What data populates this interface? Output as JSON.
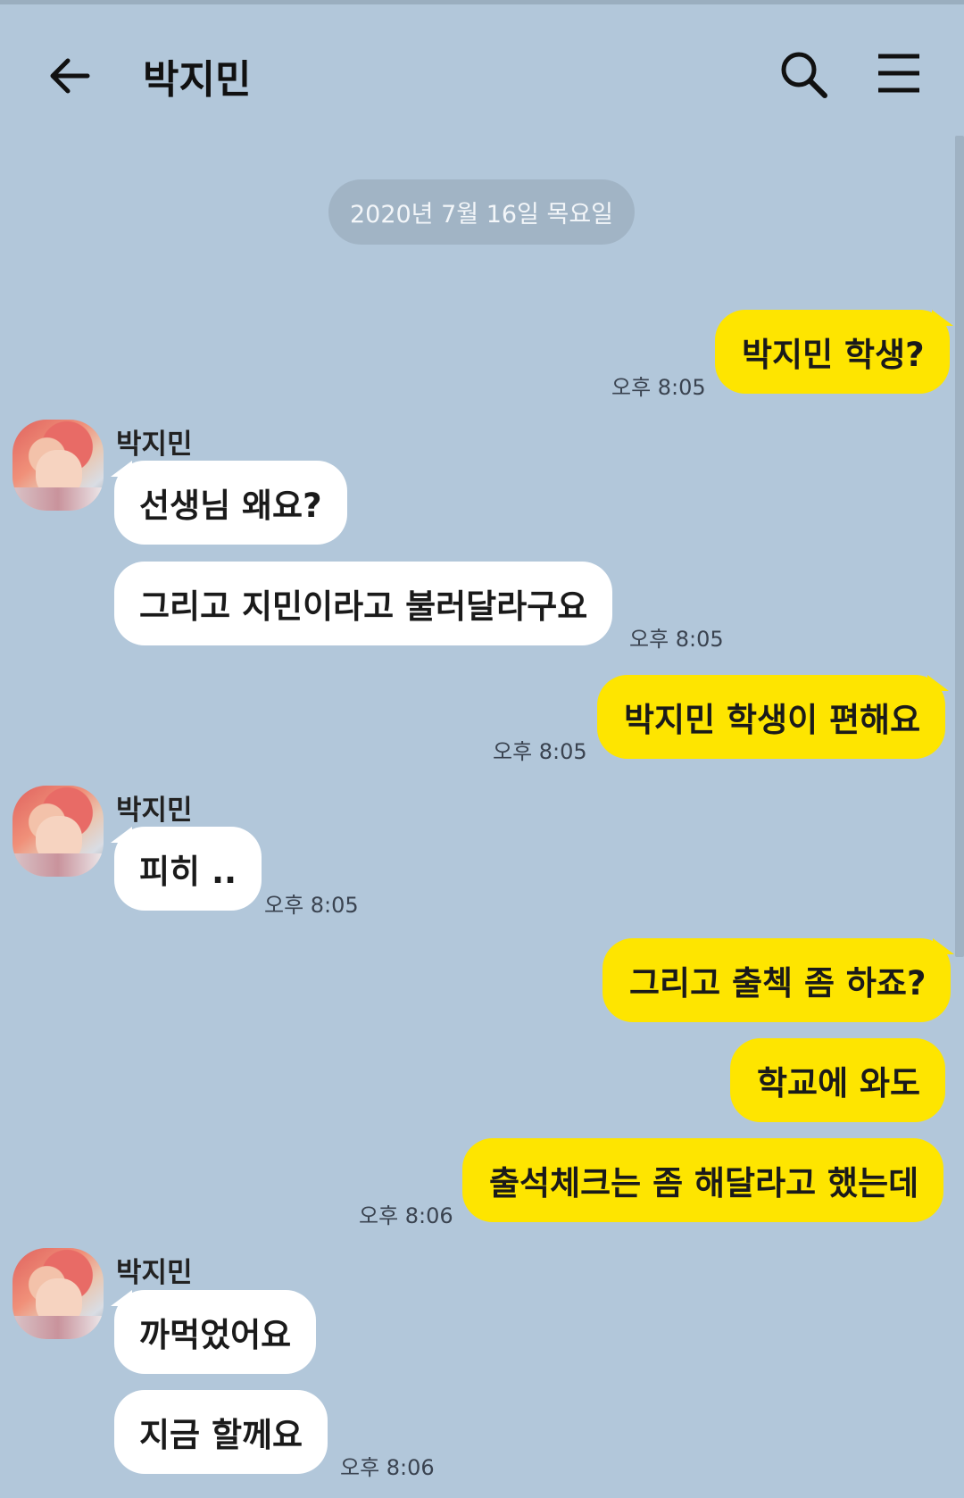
{
  "header": {
    "title": "박지민"
  },
  "date_divider": "2020년 7월 16일 목요일",
  "messages": [
    {
      "text": "박지민 학생?",
      "time": "오후 8:05"
    },
    {
      "sender": "박지민",
      "text": "선생님 왜요?"
    },
    {
      "text": "그리고 지민이라고 불러달라구요",
      "time": "오후 8:05"
    },
    {
      "text": "박지민 학생이 편해요",
      "time": "오후 8:05"
    },
    {
      "sender": "박지민",
      "text": "피히 ..",
      "time": "오후 8:05"
    },
    {
      "text": "그리고 출첵 좀 하죠?"
    },
    {
      "text": "학교에 와도"
    },
    {
      "text": "출석체크는 좀 해달라고 했는데",
      "time": "오후 8:06"
    },
    {
      "sender": "박지민",
      "text": "까먹었어요"
    },
    {
      "text": "지금 할께요",
      "time": "오후 8:06"
    }
  ],
  "colors": {
    "background": "#b2c7da",
    "my_bubble": "#fee500",
    "their_bubble": "#ffffff"
  },
  "icons": {
    "back": "arrow-left-icon",
    "search": "search-icon",
    "menu": "hamburger-menu-icon"
  }
}
